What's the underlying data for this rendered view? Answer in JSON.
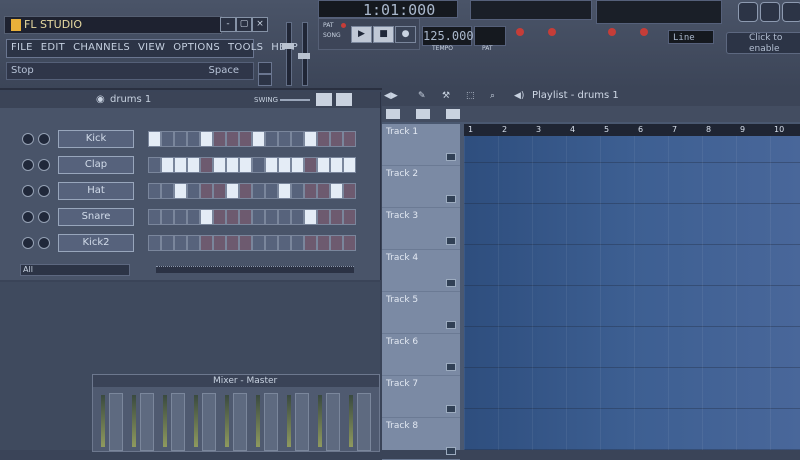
{
  "app": {
    "title": "FL STUDIO"
  },
  "window_buttons": [
    "-",
    "▢",
    "×"
  ],
  "menu": [
    "FILE",
    "EDIT",
    "CHANNELS",
    "VIEW",
    "OPTIONS",
    "TOOLS",
    "HELP"
  ],
  "hint_bar": {
    "left": "Stop",
    "right": "Space"
  },
  "transport": {
    "pat_label": "PAT",
    "song_label": "SONG",
    "time": "1:01:000",
    "tempo": "125.000",
    "tempo_label": "TEMPO",
    "pat_small": "PAT",
    "line_select": "Line",
    "click_hint": "Click to enable"
  },
  "channel_rack": {
    "title": "drums 1",
    "swing_label": "SWING",
    "channels": [
      {
        "name": "Kick",
        "steps": [
          1,
          0,
          0,
          0,
          1,
          0,
          0,
          0,
          1,
          0,
          0,
          0,
          1,
          0,
          0,
          0
        ]
      },
      {
        "name": "Clap",
        "steps": [
          0,
          1,
          1,
          1,
          0,
          1,
          1,
          1,
          0,
          1,
          1,
          1,
          0,
          1,
          1,
          1
        ]
      },
      {
        "name": "Hat",
        "steps": [
          0,
          0,
          1,
          0,
          0,
          0,
          1,
          0,
          0,
          0,
          1,
          0,
          0,
          0,
          1,
          0
        ]
      },
      {
        "name": "Snare",
        "steps": [
          0,
          0,
          0,
          0,
          1,
          0,
          0,
          0,
          0,
          0,
          0,
          0,
          1,
          0,
          0,
          0
        ]
      },
      {
        "name": "Kick2",
        "steps": [
          0,
          0,
          0,
          0,
          0,
          0,
          0,
          0,
          0,
          0,
          0,
          0,
          0,
          0,
          0,
          0
        ]
      }
    ],
    "bottom_select": "All"
  },
  "mixer": {
    "title": "Mixer - Master"
  },
  "playlist": {
    "title": "Playlist - drums 1",
    "bars": [
      "1",
      "2",
      "3",
      "4",
      "5",
      "6",
      "7",
      "8",
      "9",
      "10"
    ],
    "tracks": [
      "Track 1",
      "Track 2",
      "Track 3",
      "Track 4",
      "Track 5",
      "Track 6",
      "Track 7",
      "Track 8"
    ]
  },
  "colors": {
    "step_on": "#e4ecf6",
    "step_off": "#57637c",
    "step_off_alt": "#6d5a6f",
    "record": "#c53d38",
    "playlist_grid": "#3d5f92"
  }
}
